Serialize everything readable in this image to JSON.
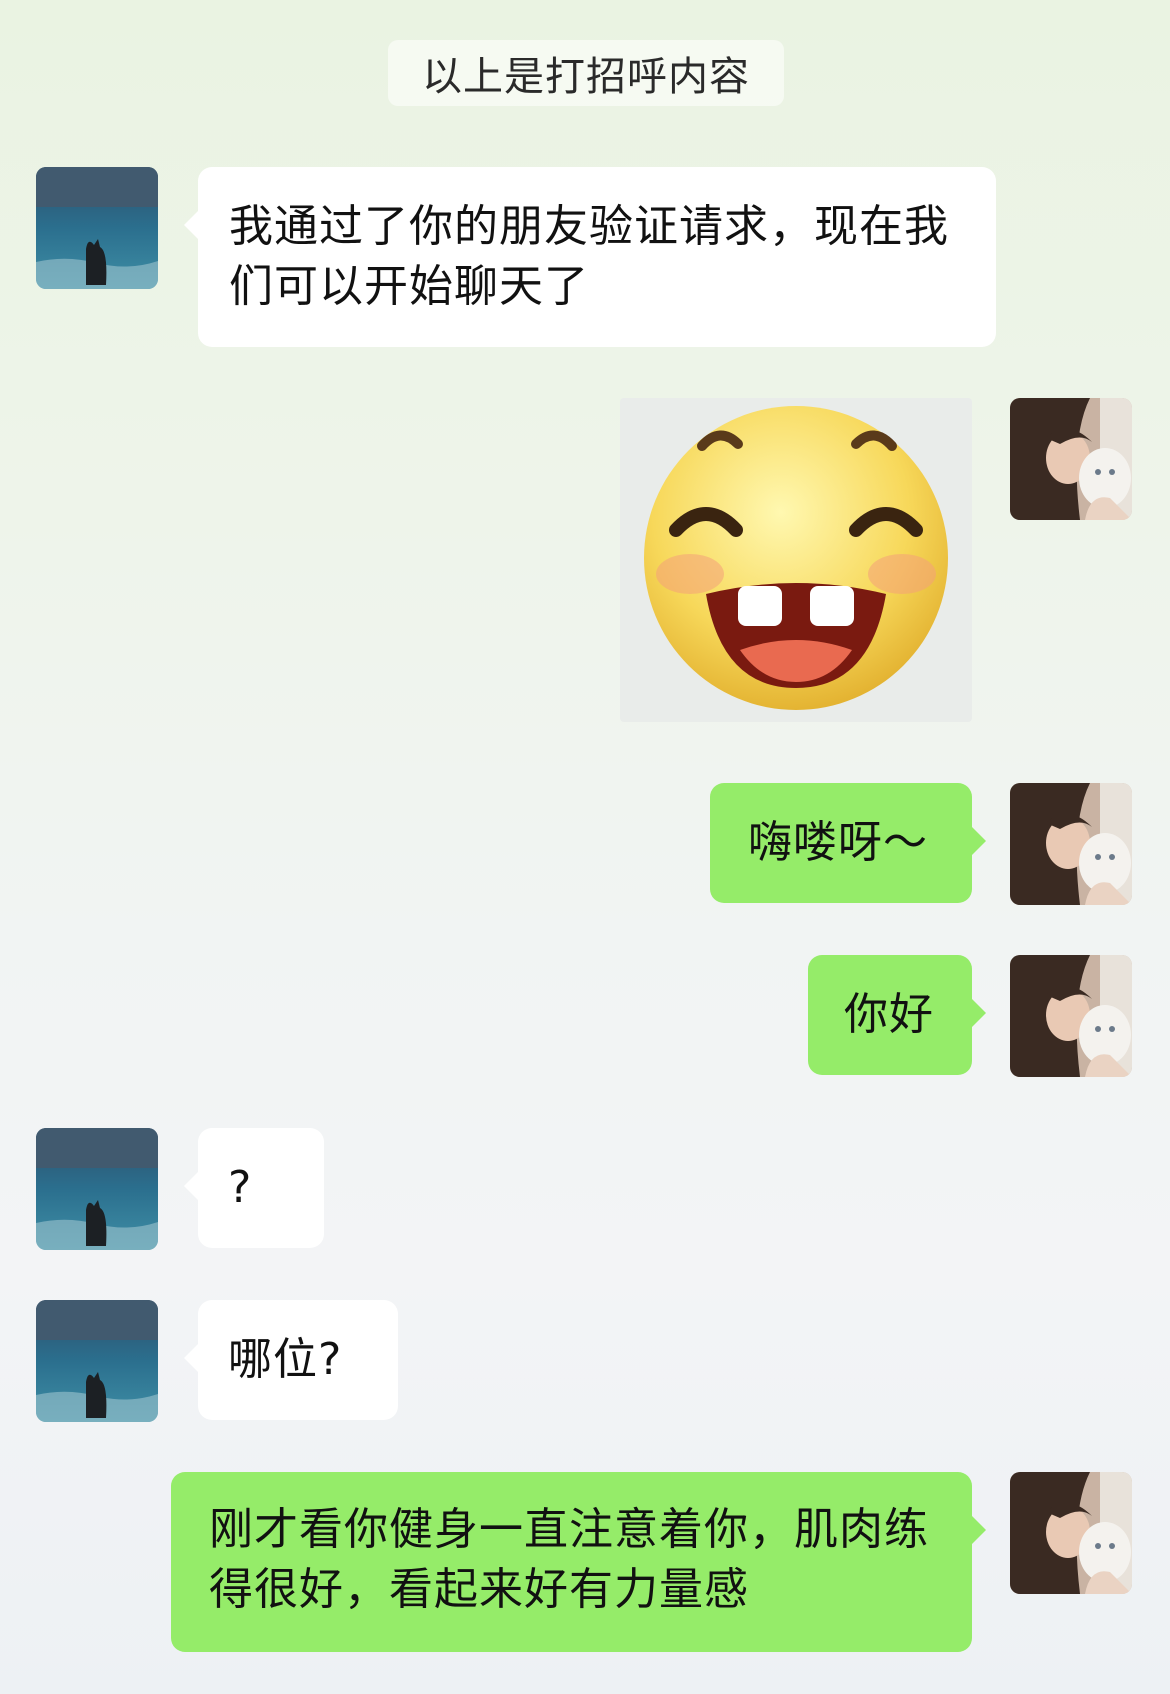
{
  "system_note": "以上是打招呼内容",
  "messages": [
    {
      "from": "other",
      "text": "我通过了你的朋友验证请求，现在我们可以开始聊天了"
    },
    {
      "from": "me",
      "type": "sticker",
      "sticker": "grinning-gap-tooth-emoji"
    },
    {
      "from": "me",
      "text": "嗨喽呀～"
    },
    {
      "from": "me",
      "text": "你好"
    },
    {
      "from": "other",
      "text": "?"
    },
    {
      "from": "other",
      "text": "哪位?"
    },
    {
      "from": "me",
      "text": "刚才看你健身一直注意着你，肌肉练得很好，看起来好有力量感"
    }
  ],
  "avatars": {
    "other": "cat-by-sea-avatar",
    "me": "girl-with-white-cat-avatar"
  },
  "colors": {
    "outgoing_bubble": "#95ec69",
    "incoming_bubble": "#ffffff"
  }
}
